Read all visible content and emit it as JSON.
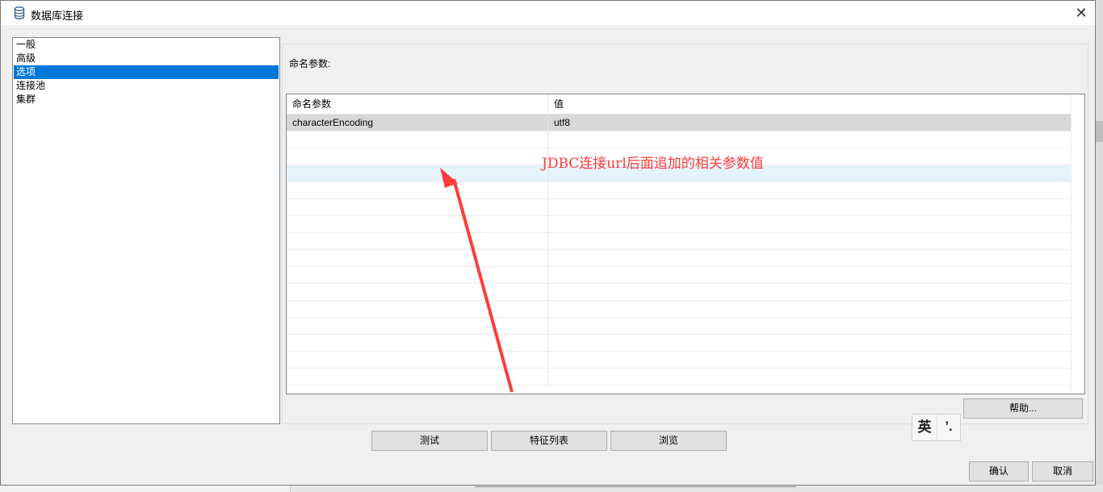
{
  "window": {
    "title": "数据库连接",
    "close_symbol": "✕"
  },
  "nav": {
    "items": [
      {
        "label": "一般",
        "selected": false
      },
      {
        "label": "高级",
        "selected": false
      },
      {
        "label": "选项",
        "selected": true
      },
      {
        "label": "连接池",
        "selected": false
      },
      {
        "label": "集群",
        "selected": false
      }
    ]
  },
  "options": {
    "section_label": "命名参数:",
    "grid": {
      "columns": [
        "命名参数",
        "值"
      ],
      "rows": [
        {
          "name": "characterEncoding",
          "value": "utf8"
        }
      ],
      "empty_row_count": 15
    }
  },
  "annotation": {
    "text": "JDBC连接url后面追加的相关参数值",
    "color": "#ff3b3b"
  },
  "buttons": {
    "help": "帮助...",
    "test": "测试",
    "features": "特征列表",
    "browse": "浏览",
    "ok": "确认",
    "cancel": "取消"
  },
  "ime": {
    "lang": "英",
    "punct": "’."
  },
  "colors": {
    "selection": "#0078d7",
    "row_data": "#d9d9d9",
    "row_hover": "#e5f3fb"
  }
}
